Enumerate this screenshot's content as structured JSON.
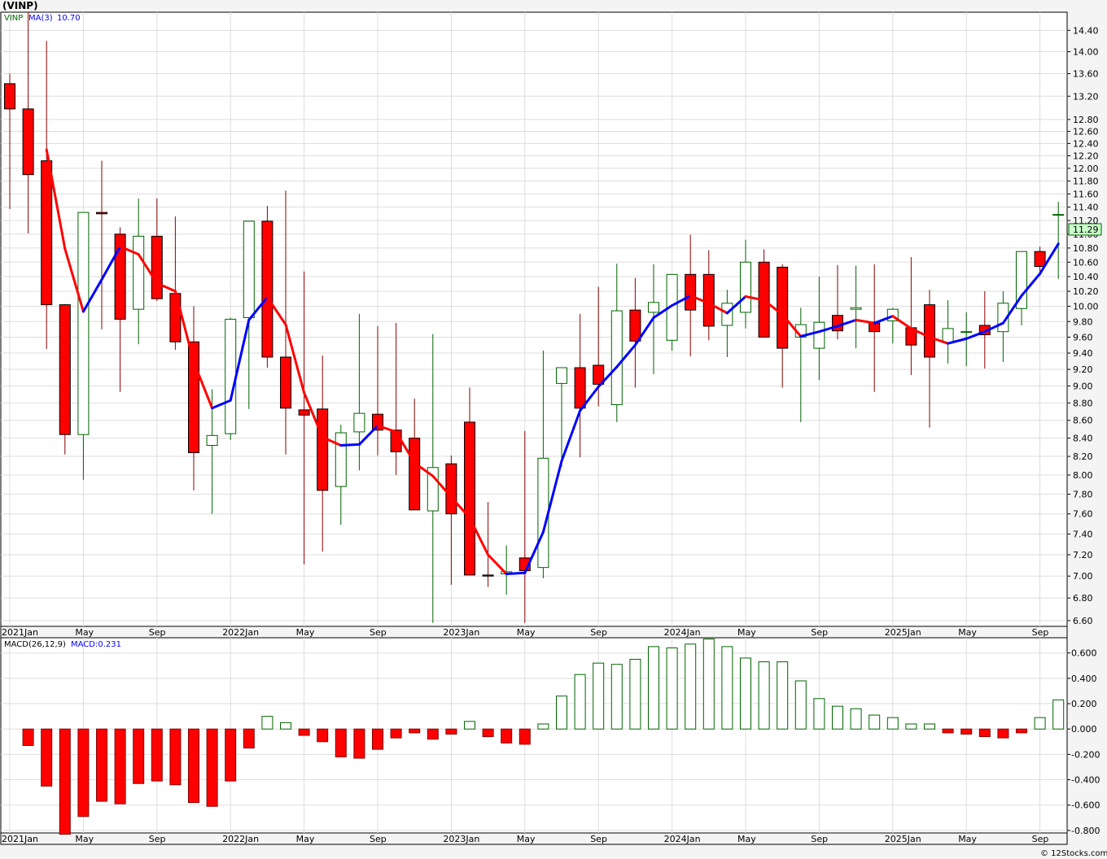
{
  "title": "(VINP)",
  "watermark": "© 12Stocks.com",
  "colors": {
    "up_candle_stroke": "#006400",
    "down_candle_fill": "#ff0000",
    "ma_up": "#0000ff",
    "ma_down": "#ff0000",
    "grid": "#dddddd",
    "background": "#ffffff",
    "symbol_legend": "#006400",
    "ma_legend": "#0000ff",
    "last_price_box": "#ccffcc"
  },
  "x_axis_labels": [
    {
      "label": "2021Jan",
      "index": 0
    },
    {
      "label": "May",
      "index": 4
    },
    {
      "label": "Sep",
      "index": 8
    },
    {
      "label": "2022Jan",
      "index": 12
    },
    {
      "label": "May",
      "index": 16
    },
    {
      "label": "Sep",
      "index": 20
    },
    {
      "label": "2023Jan",
      "index": 24
    },
    {
      "label": "May",
      "index": 28
    },
    {
      "label": "Sep",
      "index": 32
    },
    {
      "label": "2024Jan",
      "index": 36
    },
    {
      "label": "May",
      "index": 40
    },
    {
      "label": "Sep",
      "index": 44
    },
    {
      "label": "2025Jan",
      "index": 48
    },
    {
      "label": "May",
      "index": 52
    },
    {
      "label": "Sep",
      "index": 56
    }
  ],
  "price_panel": {
    "symbol_label": "VINP",
    "ma_label": "MA(3)",
    "ma_value": "10.70",
    "last_price": "11.29",
    "y_ticks": [
      "14.40",
      "14.00",
      "13.60",
      "13.20",
      "12.80",
      "12.60",
      "12.40",
      "12.20",
      "12.00",
      "11.80",
      "11.60",
      "11.40",
      "11.20",
      "11.00",
      "10.80",
      "10.60",
      "10.40",
      "10.20",
      "10.00",
      "9.80",
      "9.60",
      "9.40",
      "9.20",
      "9.00",
      "8.80",
      "8.60",
      "8.40",
      "8.20",
      "8.00",
      "7.80",
      "7.60",
      "7.40",
      "7.20",
      "7.00",
      "6.80",
      "6.60"
    ]
  },
  "macd_panel": {
    "label": "MACD(26,12,9)",
    "value_label": "MACD:0.231",
    "y_ticks": [
      "0.600",
      "0.400",
      "0.200",
      "0.000",
      "-0.200",
      "-0.400",
      "-0.600",
      "-0.800"
    ]
  },
  "chart_data": [
    {
      "type": "candlestick",
      "title": "(VINP)",
      "scale": "log",
      "ylim": [
        6.55,
        14.75
      ],
      "x": [
        "2021-01",
        "2021-02",
        "2021-03",
        "2021-04",
        "2021-05",
        "2021-06",
        "2021-07",
        "2021-08",
        "2021-09",
        "2021-10",
        "2021-11",
        "2021-12",
        "2022-01",
        "2022-02",
        "2022-03",
        "2022-04",
        "2022-05",
        "2022-06",
        "2022-07",
        "2022-08",
        "2022-09",
        "2022-10",
        "2022-11",
        "2022-12",
        "2023-01",
        "2023-02",
        "2023-03",
        "2023-04",
        "2023-05",
        "2023-06",
        "2023-07",
        "2023-08",
        "2023-09",
        "2023-10",
        "2023-11",
        "2023-12",
        "2024-01",
        "2024-02",
        "2024-03",
        "2024-04",
        "2024-05",
        "2024-06",
        "2024-07",
        "2024-08",
        "2024-09",
        "2024-10",
        "2024-11",
        "2024-12",
        "2025-01",
        "2025-02",
        "2025-03",
        "2025-04",
        "2025-05",
        "2025-06",
        "2025-07",
        "2025-08",
        "2025-09",
        "2025-10"
      ],
      "open": [
        13.42,
        12.98,
        12.12,
        10.02,
        8.44,
        11.32,
        11.0,
        9.96,
        10.97,
        10.17,
        9.54,
        8.32,
        8.45,
        9.85,
        11.19,
        9.35,
        8.72,
        8.73,
        7.88,
        8.47,
        8.67,
        8.49,
        8.4,
        7.63,
        8.12,
        8.58,
        7.01,
        7.02,
        7.17,
        7.08,
        9.03,
        9.22,
        9.25,
        8.78,
        9.95,
        9.92,
        9.56,
        10.43,
        10.43,
        9.75,
        9.92,
        10.6,
        10.53,
        9.6,
        9.46,
        9.88,
        9.96,
        9.78,
        9.81,
        9.72,
        10.02,
        9.53,
        9.67,
        9.75,
        9.67,
        9.97,
        10.75,
        11.29
      ],
      "high": [
        13.6,
        14.75,
        14.2,
        10.03,
        11.1,
        12.12,
        11.1,
        11.53,
        11.53,
        11.26,
        10.0,
        8.96,
        9.85,
        10.52,
        11.42,
        11.65,
        10.47,
        9.37,
        8.55,
        9.9,
        9.74,
        9.78,
        8.85,
        9.64,
        8.21,
        8.98,
        7.72,
        7.29,
        8.48,
        9.43,
        9.2,
        9.9,
        10.26,
        10.58,
        10.38,
        10.57,
        10.38,
        10.99,
        10.77,
        10.22,
        10.92,
        10.78,
        10.57,
        9.98,
        10.4,
        10.56,
        10.55,
        10.57,
        9.98,
        10.67,
        10.22,
        10.08,
        9.92,
        10.2,
        10.2,
        10.45,
        10.82,
        11.48
      ],
      "low": [
        11.37,
        11.01,
        9.45,
        8.22,
        7.95,
        9.7,
        8.93,
        9.51,
        10.07,
        9.44,
        7.84,
        7.6,
        8.38,
        8.73,
        9.22,
        8.22,
        7.11,
        7.23,
        7.49,
        8.05,
        8.21,
        8.0,
        7.85,
        6.58,
        6.92,
        7.83,
        6.9,
        6.83,
        6.58,
        6.98,
        8.09,
        8.19,
        8.76,
        8.58,
        8.98,
        9.14,
        9.43,
        9.36,
        9.56,
        9.35,
        9.71,
        9.86,
        8.98,
        8.58,
        9.07,
        9.57,
        9.46,
        8.93,
        9.52,
        9.13,
        8.52,
        9.27,
        9.24,
        9.21,
        9.29,
        9.75,
        10.41,
        10.37
      ],
      "close": [
        12.98,
        11.9,
        10.02,
        8.44,
        11.32,
        11.3,
        9.83,
        10.97,
        10.1,
        9.54,
        8.24,
        8.43,
        9.83,
        11.19,
        9.35,
        8.74,
        8.66,
        7.84,
        8.46,
        8.68,
        8.49,
        8.25,
        7.64,
        8.08,
        7.6,
        7.01,
        7.0,
        7.04,
        7.05,
        8.18,
        9.22,
        8.74,
        9.02,
        9.94,
        9.55,
        10.05,
        10.43,
        9.95,
        9.74,
        10.04,
        10.6,
        9.6,
        9.46,
        9.76,
        9.79,
        9.68,
        9.98,
        9.67,
        9.96,
        9.5,
        9.35,
        9.71,
        9.67,
        9.63,
        10.04,
        10.75,
        10.54,
        11.29
      ],
      "ma3": [
        null,
        null,
        12.3,
        10.79,
        9.93,
        10.36,
        10.82,
        10.71,
        10.31,
        10.2,
        9.29,
        8.74,
        8.83,
        9.82,
        10.12,
        9.76,
        8.92,
        8.41,
        8.32,
        8.33,
        8.54,
        8.47,
        8.13,
        7.99,
        7.77,
        7.56,
        7.2,
        7.02,
        7.03,
        7.42,
        8.15,
        8.71,
        8.99,
        9.23,
        9.5,
        9.85,
        10.01,
        10.14,
        10.04,
        9.91,
        10.13,
        10.08,
        9.89,
        9.61,
        9.67,
        9.74,
        9.82,
        9.78,
        9.87,
        9.71,
        9.6,
        9.52,
        9.58,
        9.67,
        9.78,
        10.14,
        10.44,
        10.86
      ]
    },
    {
      "type": "bar",
      "title": "MACD(26,12,9)",
      "ylim": [
        -0.82,
        0.72
      ],
      "values": [
        -0.13,
        -0.45,
        -0.83,
        -0.69,
        -0.57,
        -0.59,
        -0.43,
        -0.41,
        -0.44,
        -0.58,
        -0.61,
        -0.41,
        -0.15,
        0.1,
        0.05,
        -0.05,
        -0.1,
        -0.22,
        -0.23,
        -0.16,
        -0.07,
        -0.03,
        -0.08,
        -0.04,
        0.06,
        -0.06,
        -0.11,
        -0.12,
        0.04,
        0.26,
        0.43,
        0.52,
        0.51,
        0.55,
        0.65,
        0.64,
        0.67,
        0.71,
        0.65,
        0.56,
        0.53,
        0.53,
        0.38,
        0.24,
        0.18,
        0.16,
        0.11,
        0.09,
        0.04,
        0.04,
        -0.03,
        -0.04,
        -0.06,
        -0.07,
        -0.03,
        0.09,
        0.23
      ]
    }
  ]
}
